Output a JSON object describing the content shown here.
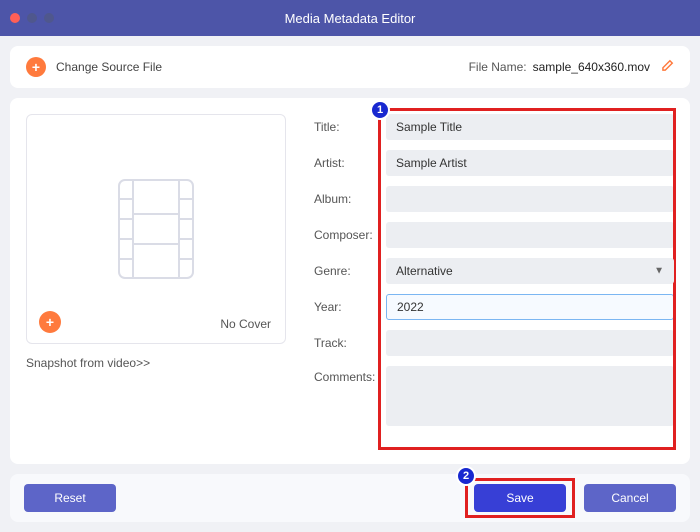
{
  "window_title": "Media Metadata Editor",
  "file_bar": {
    "change_source_label": "Change Source File",
    "file_name_label": "File Name:",
    "file_name_value": "sample_640x360.mov"
  },
  "cover": {
    "no_cover_label": "No Cover",
    "snapshot_link": "Snapshot from video>>"
  },
  "form": {
    "title_label": "Title:",
    "title_value": "Sample Title",
    "artist_label": "Artist:",
    "artist_value": "Sample Artist",
    "album_label": "Album:",
    "album_value": "",
    "composer_label": "Composer:",
    "composer_value": "",
    "genre_label": "Genre:",
    "genre_value": "Alternative",
    "year_label": "Year:",
    "year_value": "2022",
    "track_label": "Track:",
    "track_value": "",
    "comments_label": "Comments:",
    "comments_value": ""
  },
  "buttons": {
    "reset": "Reset",
    "save": "Save",
    "cancel": "Cancel"
  },
  "annotations": {
    "badge1": "1",
    "badge2": "2"
  }
}
